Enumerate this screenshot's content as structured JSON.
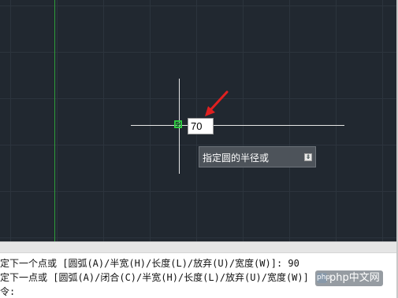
{
  "canvas": {
    "dynamic_input_value": "70",
    "tooltip": {
      "prompt": "指定圆的半径或",
      "options_button": "⇟"
    }
  },
  "command_line": {
    "lines": [
      "定下一个点或 [圆弧(A)/半宽(H)/长度(L)/放弃(U)/宽度(W)]: 90",
      "定下一点或 [圆弧(A)/闭合(C)/半宽(H)/长度(L)/放弃(U)/宽度(W)]",
      "令:"
    ]
  },
  "watermark": {
    "text": "php中文网",
    "logo_glyph": "php"
  },
  "colors": {
    "canvas_bg": "#212830",
    "grid": "#2c343d",
    "y_axis": "#2f9e3a",
    "crosshair": "#e6e6e6",
    "pickbox": "#2ecc40",
    "arrow": "#e02020",
    "tooltip_bg": "#4d535a"
  }
}
